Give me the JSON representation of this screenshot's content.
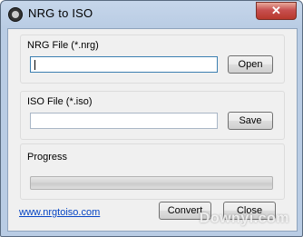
{
  "window": {
    "title": "NRG to  ISO",
    "close_glyph": "✕"
  },
  "nrg_group": {
    "label": "NRG File (*.nrg)",
    "value": "",
    "open_label": "Open"
  },
  "iso_group": {
    "label": "ISO File (*.iso)",
    "value": "",
    "save_label": "Save"
  },
  "progress_group": {
    "label": "Progress",
    "progress_fraction": 0
  },
  "footer": {
    "link_text": "www.nrgtoiso.com",
    "convert_label": "Convert",
    "close_label": "Close"
  },
  "watermark": {
    "text": "Downyi.com"
  },
  "colors": {
    "link": "#0645c4",
    "close_button": "#c75050",
    "progress_fill": "#06b025"
  }
}
